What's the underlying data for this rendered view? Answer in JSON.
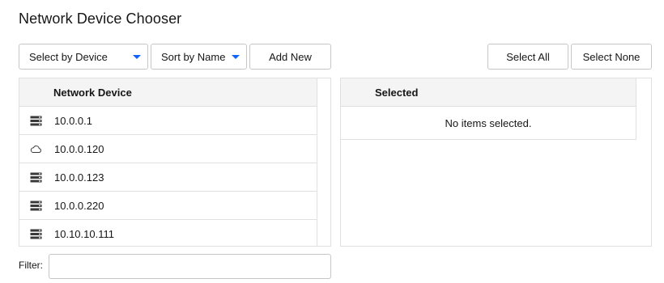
{
  "title": "Network Device Chooser",
  "toolbar": {
    "select_by": "Select by Device",
    "sort_by": "Sort by Name",
    "add_new": "Add New",
    "select_all": "Select All",
    "select_none": "Select None"
  },
  "available": {
    "header": "Network Device",
    "items": [
      {
        "label": "10.0.0.1",
        "icon": "server-icon"
      },
      {
        "label": "10.0.0.120",
        "icon": "cloud-icon"
      },
      {
        "label": "10.0.0.123",
        "icon": "server-icon"
      },
      {
        "label": "10.0.0.220",
        "icon": "server-icon"
      },
      {
        "label": "10.10.10.111",
        "icon": "server-icon"
      }
    ]
  },
  "selected": {
    "header": "Selected",
    "empty_text": "No items selected."
  },
  "filter": {
    "label": "Filter:",
    "value": "",
    "placeholder": ""
  },
  "colors": {
    "accent": "#0f62fe",
    "border": "#e0e0e0",
    "header_bg": "#f4f4f4"
  }
}
